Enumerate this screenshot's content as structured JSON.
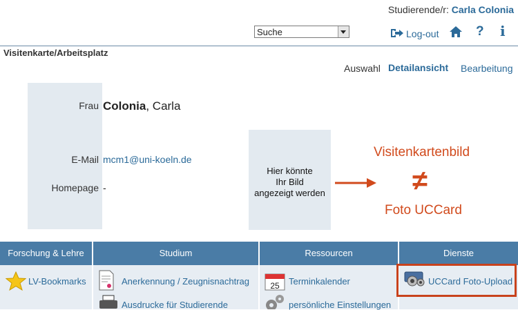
{
  "header": {
    "user_prefix": "Studierende/r:",
    "user_name": "Carla Colonia",
    "search_value": "Suche",
    "logout_label": "Log-out",
    "help_glyph": "?",
    "info_glyph": "i",
    "icons": [
      "logout-icon",
      "home-icon",
      "help-icon",
      "info-icon"
    ]
  },
  "page": {
    "title": "Visitenkarte/Arbeitsplatz"
  },
  "view_tabs": {
    "auswahl": "Auswahl",
    "detail": "Detailansicht",
    "edit": "Bearbeitung"
  },
  "card": {
    "salutation": "Frau",
    "last_name": "Colonia",
    "first_name_part": ", Carla",
    "email_label": "E-Mail",
    "email": "mcm1@uni-koeln.de",
    "homepage_label": "Homepage",
    "homepage": "-",
    "photo_line1": "Hier könnte",
    "photo_line2": "Ihr Bild",
    "photo_line3": "angezeigt werden"
  },
  "annotation": {
    "top": "Visitenkartenbild",
    "symbol": "≠",
    "bottom": "Foto UCCard",
    "color": "#d14a1c"
  },
  "nav": {
    "col1": {
      "header": "Forschung & Lehre",
      "item1": "LV-Bookmarks"
    },
    "col2": {
      "header": "Studium",
      "item1": "Anerkennung / Zeugnisnachtrag",
      "item2": "Ausdrucke für Studierende"
    },
    "col3": {
      "header": "Ressourcen",
      "item1": "Terminkalender",
      "item2": "persönliche Einstellungen",
      "calendar_day": "25"
    },
    "col4": {
      "header": "Dienste",
      "item1": "UCCard Foto-Upload"
    }
  },
  "colors": {
    "accent": "#2b6a99",
    "nav_header": "#4a7ca6",
    "panel": "#e3eaf0"
  }
}
